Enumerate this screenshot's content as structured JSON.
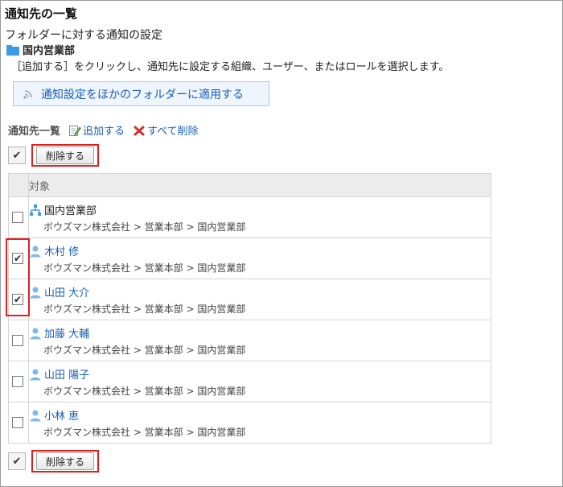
{
  "page": {
    "title": "通知先の一覧",
    "subtitle": "フォルダーに対する通知の設定",
    "folder_name": "国内営業部",
    "instruction": "［追加する］をクリックし、通知先に設定する組織、ユーザー、またはロールを選択します。",
    "apply_button_label": "通知設定をほかのフォルダーに適用する"
  },
  "list": {
    "title": "通知先一覧",
    "add_label": "追加する",
    "delete_all_label": "すべて削除",
    "delete_label": "削除する",
    "column_header": "対象",
    "rows": [
      {
        "type": "org",
        "name": "国内営業部",
        "path": "ボウズマン株式会社 > 営業本部 > 国内営業部",
        "checked": false
      },
      {
        "type": "user",
        "name": "木村 修",
        "path": "ボウズマン株式会社 > 営業本部 > 国内営業部",
        "checked": true
      },
      {
        "type": "user",
        "name": "山田 大介",
        "path": "ボウズマン株式会社 > 営業本部 > 国内営業部",
        "checked": true
      },
      {
        "type": "user",
        "name": "加藤 大輔",
        "path": "ボウズマン株式会社 > 営業本部 > 国内営業部",
        "checked": false
      },
      {
        "type": "user",
        "name": "山田 陽子",
        "path": "ボウズマン株式会社 > 営業本部 > 国内営業部",
        "checked": false
      },
      {
        "type": "user",
        "name": "小林 恵",
        "path": "ボウズマン株式会社 > 営業本部 > 国内営業部",
        "checked": false
      }
    ]
  },
  "colors": {
    "link": "#1a5fb4",
    "highlight": "#e01f1f",
    "icon_blue": "#3b9be6"
  }
}
